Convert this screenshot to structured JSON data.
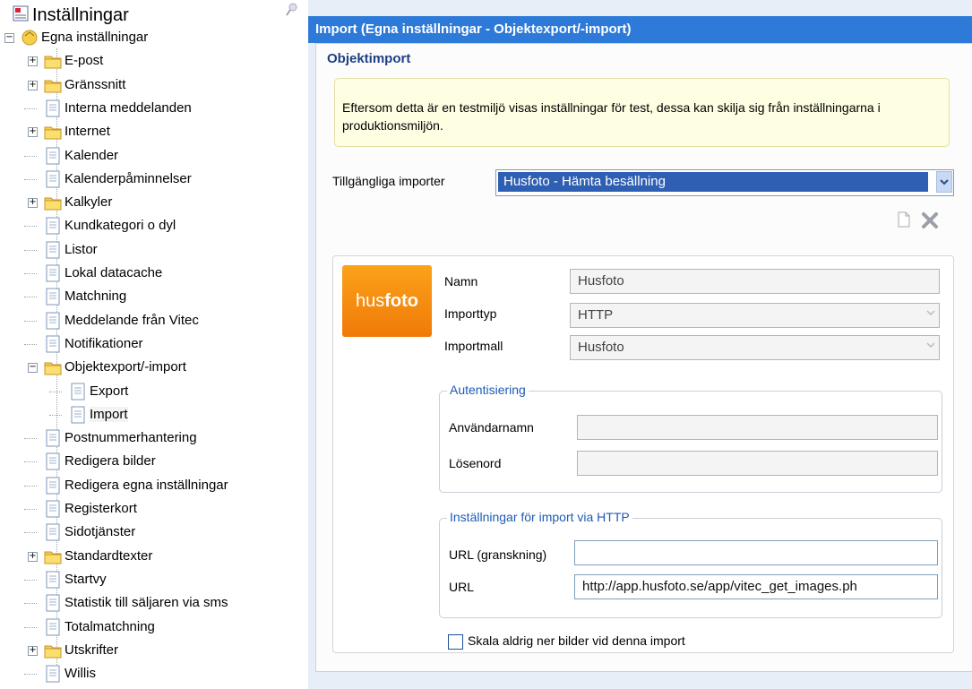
{
  "left_panel": {
    "title": "Inställningar",
    "tree": [
      {
        "label": "Egna inställningar",
        "type": "root",
        "level": 0,
        "expander": "−"
      },
      {
        "label": "E-post",
        "type": "folder",
        "level": 1,
        "expander": "+"
      },
      {
        "label": "Gränssnitt",
        "type": "folder",
        "level": 1,
        "expander": "+"
      },
      {
        "label": "Interna meddelanden",
        "type": "page",
        "level": 1
      },
      {
        "label": "Internet",
        "type": "folder",
        "level": 1,
        "expander": "+"
      },
      {
        "label": "Kalender",
        "type": "page",
        "level": 1
      },
      {
        "label": "Kalenderpåminnelser",
        "type": "page",
        "level": 1
      },
      {
        "label": "Kalkyler",
        "type": "folder",
        "level": 1,
        "expander": "+"
      },
      {
        "label": "Kundkategori o dyl",
        "type": "page",
        "level": 1
      },
      {
        "label": "Listor",
        "type": "page",
        "level": 1
      },
      {
        "label": "Lokal datacache",
        "type": "page",
        "level": 1
      },
      {
        "label": "Matchning",
        "type": "page",
        "level": 1
      },
      {
        "label": "Meddelande från Vitec",
        "type": "page",
        "level": 1
      },
      {
        "label": "Notifikationer",
        "type": "page",
        "level": 1
      },
      {
        "label": "Objektexport/-import",
        "type": "folder",
        "level": 1,
        "expander": "−"
      },
      {
        "label": "Export",
        "type": "page",
        "level": 2
      },
      {
        "label": "Import",
        "type": "page",
        "level": 2,
        "selected": true
      },
      {
        "label": "Postnummerhantering",
        "type": "page",
        "level": 1
      },
      {
        "label": "Redigera bilder",
        "type": "page",
        "level": 1
      },
      {
        "label": "Redigera egna inställningar",
        "type": "page",
        "level": 1
      },
      {
        "label": "Registerkort",
        "type": "page",
        "level": 1
      },
      {
        "label": "Sidotjänster",
        "type": "page",
        "level": 1
      },
      {
        "label": "Standardtexter",
        "type": "folder",
        "level": 1,
        "expander": "+"
      },
      {
        "label": "Startvy",
        "type": "page",
        "level": 1
      },
      {
        "label": "Statistik till säljaren via sms",
        "type": "page",
        "level": 1
      },
      {
        "label": "Totalmatchning",
        "type": "page",
        "level": 1
      },
      {
        "label": "Utskrifter",
        "type": "folder",
        "level": 1,
        "expander": "+"
      },
      {
        "label": "Willis",
        "type": "page",
        "level": 1
      }
    ]
  },
  "right_panel": {
    "title": "Import (Egna inställningar - Objektexport/-import)",
    "section_title": "Objektimport",
    "notice": "Eftersom detta är en testmiljö visas inställningar för test, dessa kan skilja sig från inställningarna i produktionsmiljön.",
    "available_imports_label": "Tillgängliga importer",
    "selected_import": "Husfoto - Hämta besällning",
    "logo": {
      "part1": "hus",
      "part2": "foto"
    },
    "fields": {
      "name_label": "Namn",
      "name_value": "Husfoto",
      "importtype_label": "Importtyp",
      "importtype_value": "HTTP",
      "importtemplate_label": "Importmall",
      "importtemplate_value": "Husfoto"
    },
    "auth_group": {
      "legend": "Autentisiering",
      "username_label": "Användarnamn",
      "username_value": "",
      "password_label": "Lösenord",
      "password_value": ""
    },
    "http_group": {
      "legend": "Inställningar för import via HTTP",
      "url_preview_label": "URL (granskning)",
      "url_preview_value": "",
      "url_label": "URL",
      "url_value": "http://app.husfoto.se/app/vitec_get_images.ph"
    },
    "checkbox_label": "Skala aldrig ner bilder vid denna import",
    "checkbox_checked": false
  },
  "colors": {
    "titlebar": "#2e7ad8",
    "selection": "#2f5fb3",
    "legend": "#1e5bb5",
    "logo": "#f58c10"
  },
  "icons": [
    "settings-icon",
    "pin-icon",
    "folder-icon",
    "page-icon",
    "new-icon",
    "delete-icon",
    "dropdown-arrow-icon"
  ]
}
